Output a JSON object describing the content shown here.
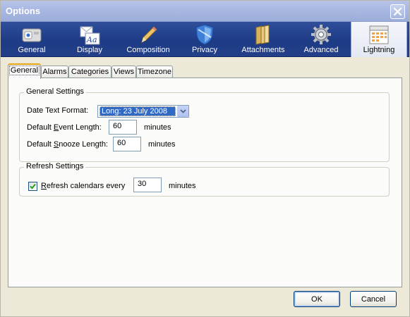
{
  "window": {
    "title": "Options"
  },
  "panes": [
    {
      "label": "General",
      "icon": "general-switch-icon"
    },
    {
      "label": "Display",
      "icon": "display-font-icon"
    },
    {
      "label": "Composition",
      "icon": "pencil-icon"
    },
    {
      "label": "Privacy",
      "icon": "shield-icon"
    },
    {
      "label": "Attachments",
      "icon": "folder-icon"
    },
    {
      "label": "Advanced",
      "icon": "gear-icon"
    },
    {
      "label": "Lightning",
      "icon": "calendar-icon",
      "selected": true
    }
  ],
  "tabs": [
    {
      "label": "General",
      "selected": true
    },
    {
      "label": "Alarms"
    },
    {
      "label": "Categories"
    },
    {
      "label": "Views"
    },
    {
      "label": "Timezone"
    }
  ],
  "general_settings": {
    "title": "General Settings",
    "date_format_label": "Date Text Format:",
    "date_format_value": "Long: 23 July 2008",
    "event_length_label_pre": "Default ",
    "event_length_label_ul": "E",
    "event_length_label_post": "vent Length:",
    "event_length_value": "60",
    "event_length_unit": "minutes",
    "snooze_label_pre": "Default ",
    "snooze_label_ul": "S",
    "snooze_label_post": "nooze Length:",
    "snooze_value": "60",
    "snooze_unit": "minutes"
  },
  "refresh_settings": {
    "title": "Refresh Settings",
    "checkbox_checked": true,
    "checkbox_label_ul": "R",
    "checkbox_label_post": "efresh calendars every",
    "interval_value": "30",
    "interval_unit": "minutes"
  },
  "buttons": {
    "ok": "OK",
    "cancel": "Cancel"
  },
  "colors": {
    "title_bar": "#a9b9e3",
    "pane_bar": "#1e3b86",
    "selection": "#316ac5",
    "tab_highlight": "#e8a40c"
  }
}
